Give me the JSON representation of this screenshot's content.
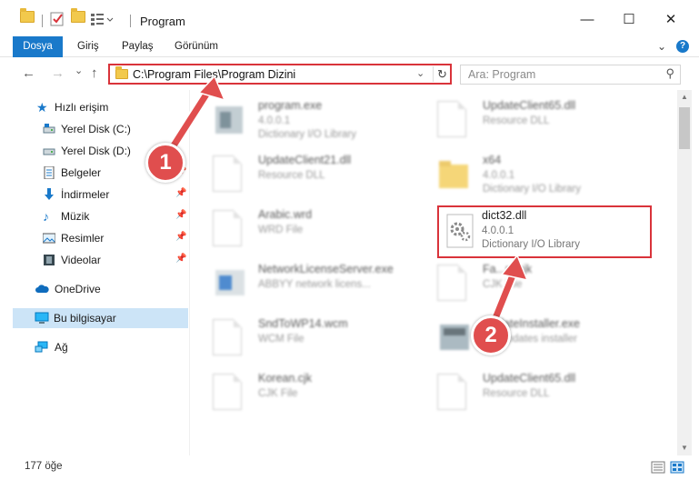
{
  "window": {
    "title": "Program",
    "minimize": "—",
    "maximize": "☐",
    "close": "✕"
  },
  "ribbon": {
    "tabs": [
      "Dosya",
      "Giriş",
      "Paylaş",
      "Görünüm"
    ],
    "expand": "⌄",
    "help": "?"
  },
  "nav": {
    "back": "←",
    "forward": "→",
    "recent": "⌄",
    "up": "↑",
    "address": "C:\\Program Files\\Program Dizini",
    "address_dropdown": "⌄",
    "refresh": "↻",
    "search_placeholder": "Ara: Program",
    "search_icon": "⚲"
  },
  "sidebar": {
    "items": [
      {
        "label": "Hızlı erişim",
        "icon": "star-icon"
      },
      {
        "label": "Yerel Disk (C:)",
        "icon": "drive-icon"
      },
      {
        "label": "Yerel Disk (D:)",
        "icon": "drive-icon"
      },
      {
        "label": "Belgeler",
        "icon": "documents-icon"
      },
      {
        "label": "İndirmeler",
        "icon": "download-icon"
      },
      {
        "label": "Müzik",
        "icon": "music-icon"
      },
      {
        "label": "Resimler",
        "icon": "pictures-icon"
      },
      {
        "label": "Videolar",
        "icon": "videos-icon"
      },
      {
        "label": "OneDrive",
        "icon": "cloud-icon"
      },
      {
        "label": "Bu bilgisayar",
        "icon": "computer-icon"
      },
      {
        "label": "Ağ",
        "icon": "network-icon"
      }
    ],
    "pin": "📌"
  },
  "files": [
    {
      "name": "program.exe",
      "line2": "4.0.0.1",
      "line3": "Dictionary I/O Library"
    },
    {
      "name": "UpdateClient65.dll",
      "line2": "Resource DLL",
      "line3": ""
    },
    {
      "name": "UpdateClient21.dll",
      "line2": "Resource DLL",
      "line3": ""
    },
    {
      "name": "x64",
      "line2": "4.0.0.1",
      "line3": "Dictionary I/O Library"
    },
    {
      "name": "Arabic.wrd",
      "line2": "WRD File",
      "line3": ""
    },
    {
      "name": "dict32.dll",
      "line2": "4.0.0.1",
      "line3": "Dictionary I/O Library"
    },
    {
      "name": "NetworkLicenseServer.exe",
      "line2": "ABBYY network licens...",
      "line3": ""
    },
    {
      "name": "Fa...m.cjk",
      "line2": "CJK File",
      "line3": ""
    },
    {
      "name": "SndToWP14.wcm",
      "line2": "WCM File",
      "line3": ""
    },
    {
      "name": "UpdateInstaller.exe",
      "line2": "...Y updates installer",
      "line3": ""
    },
    {
      "name": "Korean.cjk",
      "line2": "CJK File",
      "line3": ""
    },
    {
      "name": "UpdateClient65.dll",
      "line2": "Resource DLL",
      "line3": ""
    }
  ],
  "status": {
    "count": "177 öğe"
  },
  "annotations": {
    "step1": "1",
    "step2": "2",
    "color": "#e04e4e"
  },
  "colors": {
    "accent": "#1979ca",
    "highlight": "#d9333a",
    "selected": "#cce4f7"
  }
}
